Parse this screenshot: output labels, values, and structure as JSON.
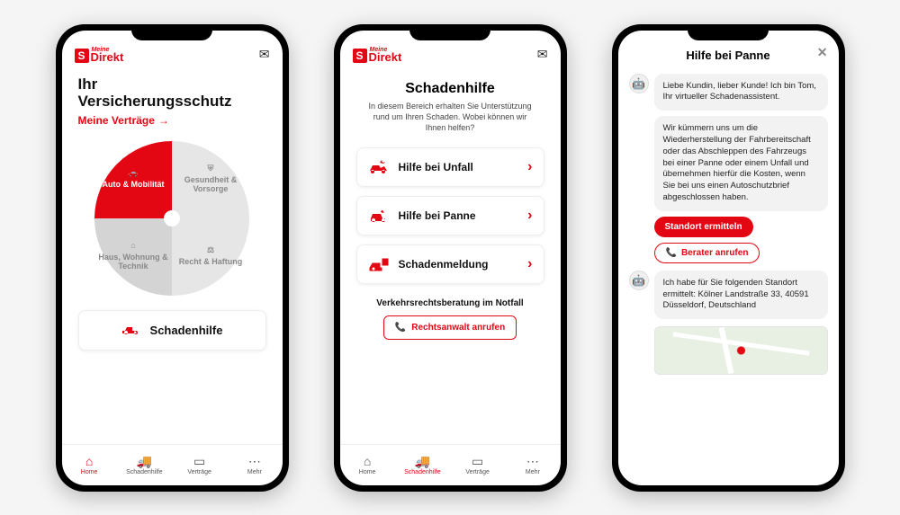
{
  "brand": {
    "super": "Meine",
    "name": "Direkt"
  },
  "screen1": {
    "title1": "Ihr",
    "title2": "Versicherungsschutz",
    "link": "Meine Verträge",
    "quads": {
      "tl": "Auto & Mobilität",
      "tr": "Gesundheit & Vorsorge",
      "bl": "Haus, Wohnung & Technik",
      "br": "Recht & Haftung"
    },
    "bigButton": "Schadenhilfe"
  },
  "tabs": {
    "home": "Home",
    "schadenhilfe": "Schadenhilfe",
    "vertraege": "Verträge",
    "mehr": "Mehr"
  },
  "screen2": {
    "title": "Schadenhilfe",
    "subtitle": "In diesem Bereich erhalten Sie Unterstützung rund um Ihren Schaden. Wobei können wir Ihnen helfen?",
    "cards": {
      "unfall": "Hilfe bei Unfall",
      "panne": "Hilfe bei Panne",
      "meldung": "Schadenmeldung"
    },
    "subheading": "Verkehrsrechtsberatung im Notfall",
    "lawyer": "Rechtsanwalt anrufen"
  },
  "screen3": {
    "title": "Hilfe bei Panne",
    "msg1": "Liebe Kundin, lieber Kunde! Ich bin Tom, Ihr virtueller Schadenassistent.",
    "msg2": "Wir kümmern uns um die Wiederherstellung der Fahrbereitschaft oder das Abschleppen des Fahrzeugs bei einer Panne oder einem Unfall und übernehmen hierfür die Kosten, wenn Sie bei uns einen Autoschutzbrief abgeschlossen haben.",
    "btn_locate": "Standort ermitteln",
    "btn_call": "Berater anrufen",
    "msg3": "Ich habe für Sie folgenden Standort ermittelt: Kölner Landstraße 33, 40591 Düsseldorf, Deutschland"
  }
}
